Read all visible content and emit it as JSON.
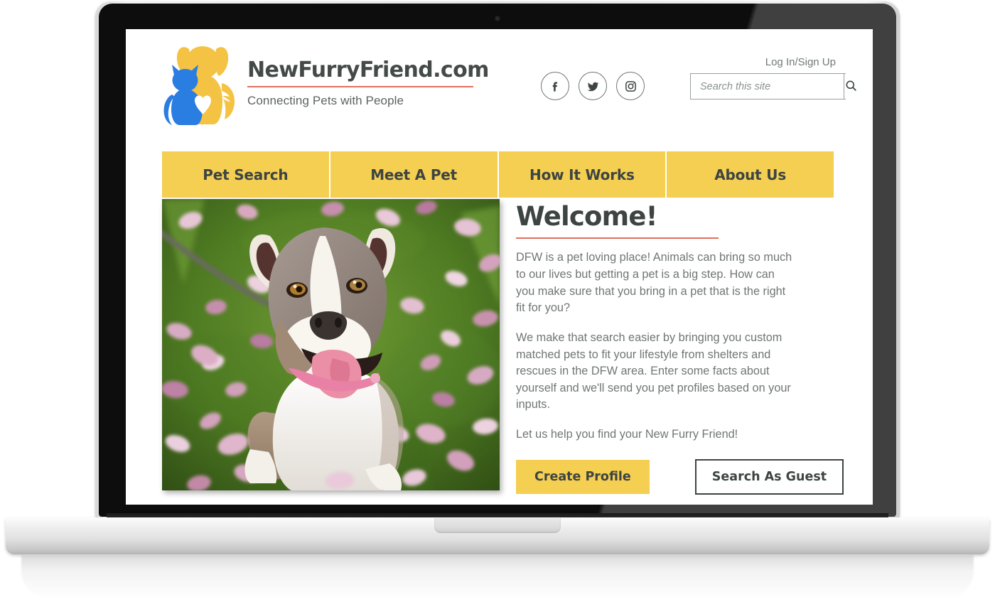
{
  "device": {
    "type": "laptop-mockup"
  },
  "header": {
    "logo": {
      "title": "NewFurryFriend.com",
      "tagline": "Connecting Pets with People",
      "mark_icon": "cat-dog-heart-logo"
    },
    "login_label": "Log In/Sign Up",
    "social": [
      {
        "name": "facebook-icon",
        "label": "Facebook"
      },
      {
        "name": "twitter-icon",
        "label": "Twitter"
      },
      {
        "name": "instagram-icon",
        "label": "Instagram"
      }
    ],
    "search": {
      "placeholder": "Search this site",
      "value": "",
      "button_icon": "search-icon"
    }
  },
  "nav": {
    "items": [
      {
        "label": "Pet Search"
      },
      {
        "label": "Meet A Pet"
      },
      {
        "label": "How It Works"
      },
      {
        "label": "About Us"
      }
    ]
  },
  "hero": {
    "photo_alt": "Smiling pit bull dog sitting on grass covered with pink cherry blossom petals",
    "title": "Welcome!",
    "paragraphs": [
      "DFW is a pet loving place! Animals can bring so much to our lives but getting a pet is a big step. How can you make sure that you bring in a pet that is the right fit for you?",
      "We make that search easier by bringing you custom matched pets to fit your lifestyle from shelters and rescues in the DFW area. Enter some facts about yourself and we'll send you pet profiles based on your inputs.",
      "Let us help you find your New Furry Friend!"
    ],
    "primary_button": "Create Profile",
    "secondary_button": "Search As Guest"
  },
  "colors": {
    "brand_yellow": "#f5cf52",
    "brand_blue": "#2a7de1",
    "accent_red": "#e2705e",
    "text_dark": "#3d4442",
    "text_body": "#6f7674"
  }
}
